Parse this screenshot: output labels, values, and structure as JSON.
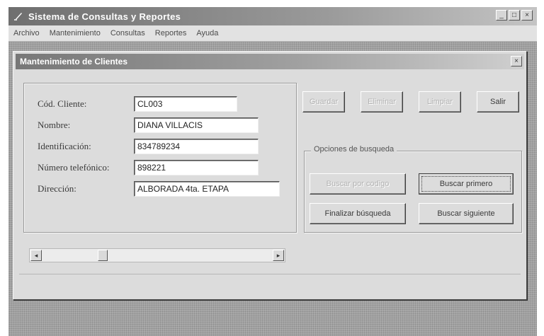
{
  "app": {
    "title": "Sistema de Consultas y Reportes",
    "window_controls": [
      "_",
      "□",
      "×"
    ]
  },
  "menu": {
    "items": [
      "Archivo",
      "Mantenimiento",
      "Consultas",
      "Reportes",
      "Ayuda"
    ]
  },
  "dialog": {
    "title": "Mantenimiento de Clientes",
    "close": "×"
  },
  "form": {
    "fields": [
      {
        "label": "Cód. Cliente:",
        "value": "CL003"
      },
      {
        "label": "Nombre:",
        "value": "DIANA VILLACIS"
      },
      {
        "label": "Identificación:",
        "value": "834789234"
      },
      {
        "label": "Número telefónico:",
        "value": "898221"
      },
      {
        "label": "Dirección:",
        "value": "ALBORADA 4ta. ETAPA"
      }
    ]
  },
  "scrollbar": {
    "left_arrow": "◂",
    "right_arrow": "▸"
  },
  "actions": {
    "guardar": "Guardar",
    "eliminar": "Eliminar",
    "limpiar": "Limpiar",
    "salir": "Salir"
  },
  "search": {
    "legend": "Opciones de busqueda",
    "buscar_por_codigo": "Buscar por codigo",
    "buscar_primero": "Buscar primero",
    "finalizar_busqueda": "Finalizar búsqueda",
    "buscar_siguiente": "Buscar siguiente"
  }
}
